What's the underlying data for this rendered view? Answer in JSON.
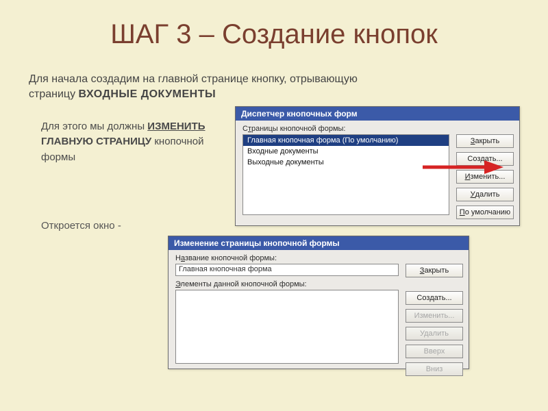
{
  "title": "ШАГ 3 – Создание кнопок",
  "intro": {
    "line1": "Для начала создадим на главной странице кнопку, отрывающую",
    "line2a": "страницу ",
    "line2b": "ВХОДНЫЕ ДОКУМЕНТЫ"
  },
  "edit_note": {
    "p1a": "Для этого мы должны ",
    "p1b": "ИЗМЕНИТЬ",
    "p2": "ГЛАВНУЮ СТРАНИЦУ",
    "p3": "кнопочной формы"
  },
  "open_note": "Откроется окно -",
  "dlg1": {
    "title": "Диспетчер кнопочных форм",
    "list_label_pre": "С",
    "list_label_accel": "т",
    "list_label_post": "раницы кнопочной формы:",
    "items": [
      "Главная кнопочная форма (По умолчанию)",
      "Входные документы",
      "Выходные документы"
    ],
    "btn_close_accel": "З",
    "btn_close_rest": "акрыть",
    "btn_new_pre": "Соз",
    "btn_new_accel": "д",
    "btn_new_post": "ать...",
    "btn_edit_accel": "И",
    "btn_edit_rest": "зменить...",
    "btn_delete_accel": "У",
    "btn_delete_rest": "далить",
    "btn_default_accel": "П",
    "btn_default_rest": "о умолчанию"
  },
  "dlg2": {
    "title": "Изменение страницы кнопочной формы",
    "name_label_pre": "Н",
    "name_label_accel": "а",
    "name_label_post": "звание кнопочной формы:",
    "name_value": "Главная кнопочная форма",
    "elements_label_accel": "Э",
    "elements_label_post": "лементы данной кнопочной формы:",
    "btn_close_accel": "З",
    "btn_close_rest": "акрыть",
    "btn_new_pre": "Соз",
    "btn_new_accel": "д",
    "btn_new_post": "ать...",
    "btn_edit": "Изменить...",
    "btn_delete": "Удалить",
    "btn_up": "Вверх",
    "btn_down": "Вниз"
  }
}
